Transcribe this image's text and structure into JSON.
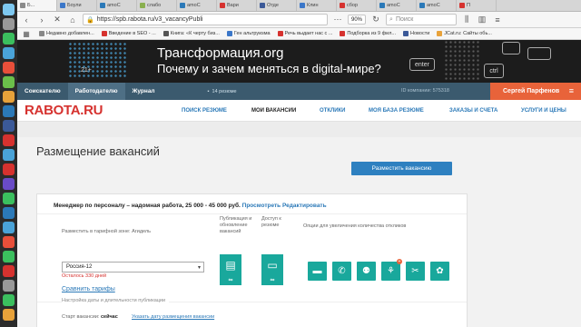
{
  "browser": {
    "tabs": [
      {
        "label": "Б...",
        "color": "#8a8a8a"
      },
      {
        "label": "Боули",
        "color": "#3b77c9"
      },
      {
        "label": "amoC",
        "color": "#2b79b8"
      },
      {
        "label": "слабо",
        "color": "#8ab04f"
      },
      {
        "label": "amoC",
        "color": "#2b79b8"
      },
      {
        "label": "Вари",
        "color": "#d6322f"
      },
      {
        "label": "Отде",
        "color": "#3b5998"
      },
      {
        "label": "Клин",
        "color": "#3b77c9"
      },
      {
        "label": "сбор",
        "color": "#d6322f"
      },
      {
        "label": "amoC",
        "color": "#2b79b8"
      },
      {
        "label": "amoC",
        "color": "#2b79b8"
      },
      {
        "label": "П",
        "color": "#d6322f"
      }
    ],
    "url": "https://spb.rabota.ru/v3_vacancyPubli",
    "zoom": "90%",
    "search_placeholder": "Поиск",
    "bookmarks": [
      {
        "label": "Недавно добавлен...",
        "color": "#888888"
      },
      {
        "label": "Введение в SEO - ...",
        "color": "#d6322f"
      },
      {
        "label": "Книга: «К черту биз...",
        "color": "#555555"
      },
      {
        "label": "Ген альтруизма",
        "color": "#3b77c9"
      },
      {
        "label": "Речь выдает нас с ...",
        "color": "#d6322f"
      },
      {
        "label": "Подборка из 9 фил...",
        "color": "#d6322f"
      },
      {
        "label": "Новости",
        "color": "#3b5998"
      },
      {
        "label": "JCat.ru: Сайты обь...",
        "color": "#e8a23a"
      }
    ]
  },
  "banner": {
    "line1": "Трансформация.org",
    "line2": "Почему и зачем меняться в digital-мире?",
    "age": "21+",
    "keys": [
      "enter",
      "ctrl"
    ]
  },
  "site": {
    "top": {
      "applicant": "Соискателю",
      "employer": "Работодателю",
      "journal": "Журнал",
      "resume_count": "14 резюме",
      "company_id": "ID компании: 575318",
      "user": "Сергей Парфенов"
    },
    "logo": "RABOTA.RU",
    "nav": [
      "ПОИСК РЕЗЮМЕ",
      "МОИ ВАКАНСИИ",
      "ОТКЛИКИ",
      "МОЯ БАЗА РЕЗЮМЕ",
      "ЗАКАЗЫ И СЧЕТА",
      "УСЛУГИ И ЦЕНЫ"
    ],
    "current_nav": "МОИ ВАКАНСИИ"
  },
  "page": {
    "title": "Размещение вакансий",
    "post_button": "Разместить вакансию",
    "vacancy": {
      "text": "Менеджер по персоналу – надомная работа, 25 000 - 45 000 руб.",
      "view_link": "Просмотреть",
      "edit_link": "Редактировать"
    },
    "zone_label": "Разместить в тарифной зоне: Агидель",
    "publish_label": "Публикация и обновление вакансий",
    "access_label": "Доступ к резюме",
    "options_label": "Опции для увеличения количества откликов",
    "region_value": "Россия-12",
    "remaining": "Осталось 330 дней",
    "tariffs_link": "Сравнить тарифы",
    "infinity": "∞",
    "settings_label": "Настройка даты и длительности публикации",
    "start_label": "Старт вакансии:",
    "start_value": "сейчас",
    "start_link": "Указать дату размещения вакансии",
    "option_badge": "+"
  }
}
